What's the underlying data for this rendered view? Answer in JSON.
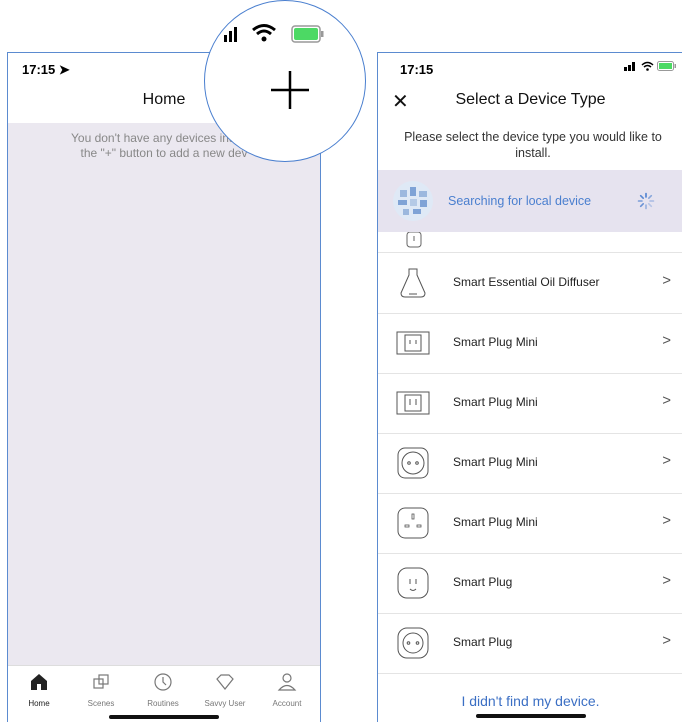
{
  "left": {
    "status_time": "17:15",
    "title": "Home",
    "empty_message_line1": "You don't have any devices installe",
    "empty_message_line2": "the \"+\" button to add a new dev",
    "tabs": [
      {
        "label": "Home",
        "icon": "home-icon",
        "active": true
      },
      {
        "label": "Scenes",
        "icon": "scenes-icon",
        "active": false
      },
      {
        "label": "Routines",
        "icon": "clock-icon",
        "active": false
      },
      {
        "label": "Savvy User",
        "icon": "diamond-icon",
        "active": false
      },
      {
        "label": "Account",
        "icon": "person-icon",
        "active": false
      }
    ],
    "magnifier_icon": "plus-icon"
  },
  "right": {
    "status_time": "17:15",
    "title": "Select a Device Type",
    "close_icon": "close-icon",
    "subtitle_line1": "Please select the device type you would like to",
    "subtitle_line2": "install.",
    "search_text": "Searching for local device",
    "devices": [
      {
        "label": "Smart Essential Oil Diffuser",
        "icon": "diffuser-icon"
      },
      {
        "label": "Smart Plug Mini",
        "icon": "plug-mini-icon"
      },
      {
        "label": "Smart Plug Mini",
        "icon": "plug-mini-icon"
      },
      {
        "label": "Smart Plug Mini",
        "icon": "round-plug-icon"
      },
      {
        "label": "Smart Plug Mini",
        "icon": "plug-uk-icon"
      },
      {
        "label": "Smart Plug",
        "icon": "plug-icon"
      },
      {
        "label": "Smart Plug",
        "icon": "plug-eu-icon"
      }
    ],
    "chevron": ">",
    "footer_link": "I didn't find my device."
  },
  "colors": {
    "accent": "#4a7fcf",
    "empty_bg": "#ebe8f0",
    "battery": "#4cd964"
  }
}
